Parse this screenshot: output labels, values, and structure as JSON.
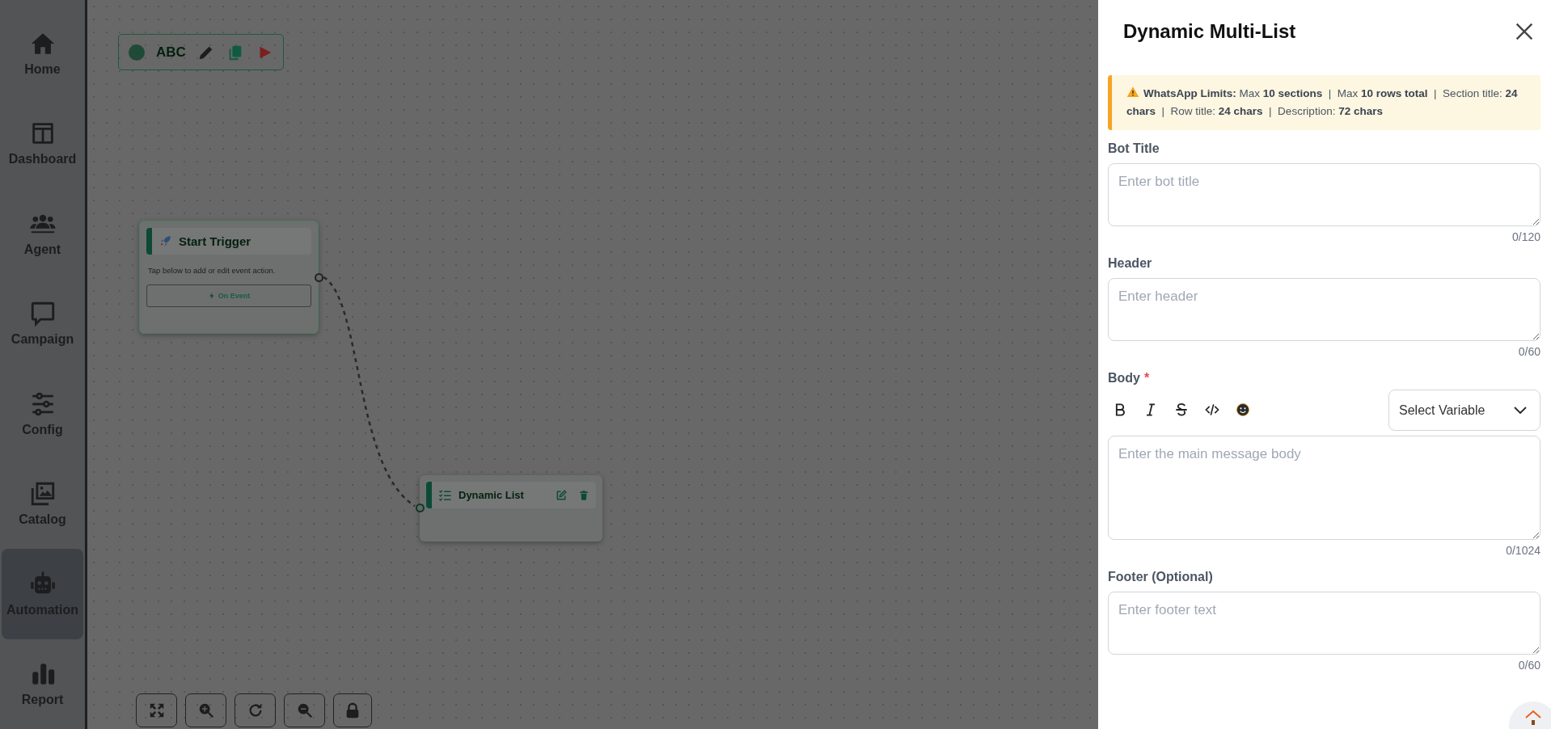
{
  "sidebar": {
    "items": [
      {
        "label": "Home",
        "selected": false
      },
      {
        "label": "Dashboard",
        "selected": false
      },
      {
        "label": "Agent",
        "selected": false
      },
      {
        "label": "Campaign",
        "selected": false
      },
      {
        "label": "Config",
        "selected": false
      },
      {
        "label": "Catalog",
        "selected": false
      },
      {
        "label": "Automation",
        "selected": true
      },
      {
        "label": "Report",
        "selected": false
      }
    ]
  },
  "canvas": {
    "toolbar": {
      "label": "ABC"
    },
    "nodes": [
      {
        "kind": "trigger",
        "title": "Start Trigger",
        "description": "Tap below to add or edit event action.",
        "button": "On Event"
      },
      {
        "kind": "list",
        "title": "Dynamic List"
      }
    ]
  },
  "panel": {
    "title": "Dynamic Multi-List",
    "notice": "**WhatsApp Limits:** Max **10 sections**  |  Max **10 rows total**  |  Section title: **24 chars**  |  Row title: **24 chars**  |  Description: **72 chars**",
    "fields": [
      {
        "kind": "text",
        "label": "Bot Title",
        "placeholder": "Enter bot title",
        "counter": "0/120"
      },
      {
        "kind": "text",
        "label": "Header",
        "placeholder": "Enter header",
        "counter": "0/60"
      },
      {
        "kind": "rich",
        "label": "Body",
        "required_mark": "*",
        "placeholder": "Enter the main message body",
        "counter": "0/1024",
        "select": "Select Variable"
      },
      {
        "kind": "text",
        "label": "Footer (Optional)",
        "placeholder": "Enter footer text",
        "counter": "0/60"
      }
    ]
  }
}
